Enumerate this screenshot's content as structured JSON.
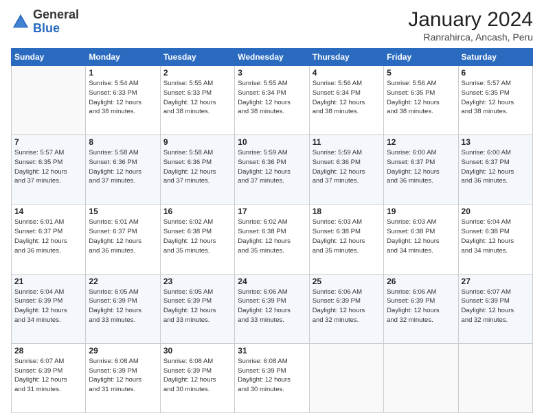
{
  "header": {
    "logo_general": "General",
    "logo_blue": "Blue",
    "title": "January 2024",
    "location": "Ranrahirca, Ancash, Peru"
  },
  "days_of_week": [
    "Sunday",
    "Monday",
    "Tuesday",
    "Wednesday",
    "Thursday",
    "Friday",
    "Saturday"
  ],
  "weeks": [
    [
      {
        "day": "",
        "info": ""
      },
      {
        "day": "1",
        "info": "Sunrise: 5:54 AM\nSunset: 6:33 PM\nDaylight: 12 hours\nand 38 minutes."
      },
      {
        "day": "2",
        "info": "Sunrise: 5:55 AM\nSunset: 6:33 PM\nDaylight: 12 hours\nand 38 minutes."
      },
      {
        "day": "3",
        "info": "Sunrise: 5:55 AM\nSunset: 6:34 PM\nDaylight: 12 hours\nand 38 minutes."
      },
      {
        "day": "4",
        "info": "Sunrise: 5:56 AM\nSunset: 6:34 PM\nDaylight: 12 hours\nand 38 minutes."
      },
      {
        "day": "5",
        "info": "Sunrise: 5:56 AM\nSunset: 6:35 PM\nDaylight: 12 hours\nand 38 minutes."
      },
      {
        "day": "6",
        "info": "Sunrise: 5:57 AM\nSunset: 6:35 PM\nDaylight: 12 hours\nand 38 minutes."
      }
    ],
    [
      {
        "day": "7",
        "info": "Sunrise: 5:57 AM\nSunset: 6:35 PM\nDaylight: 12 hours\nand 37 minutes."
      },
      {
        "day": "8",
        "info": "Sunrise: 5:58 AM\nSunset: 6:36 PM\nDaylight: 12 hours\nand 37 minutes."
      },
      {
        "day": "9",
        "info": "Sunrise: 5:58 AM\nSunset: 6:36 PM\nDaylight: 12 hours\nand 37 minutes."
      },
      {
        "day": "10",
        "info": "Sunrise: 5:59 AM\nSunset: 6:36 PM\nDaylight: 12 hours\nand 37 minutes."
      },
      {
        "day": "11",
        "info": "Sunrise: 5:59 AM\nSunset: 6:36 PM\nDaylight: 12 hours\nand 37 minutes."
      },
      {
        "day": "12",
        "info": "Sunrise: 6:00 AM\nSunset: 6:37 PM\nDaylight: 12 hours\nand 36 minutes."
      },
      {
        "day": "13",
        "info": "Sunrise: 6:00 AM\nSunset: 6:37 PM\nDaylight: 12 hours\nand 36 minutes."
      }
    ],
    [
      {
        "day": "14",
        "info": "Sunrise: 6:01 AM\nSunset: 6:37 PM\nDaylight: 12 hours\nand 36 minutes."
      },
      {
        "day": "15",
        "info": "Sunrise: 6:01 AM\nSunset: 6:37 PM\nDaylight: 12 hours\nand 36 minutes."
      },
      {
        "day": "16",
        "info": "Sunrise: 6:02 AM\nSunset: 6:38 PM\nDaylight: 12 hours\nand 35 minutes."
      },
      {
        "day": "17",
        "info": "Sunrise: 6:02 AM\nSunset: 6:38 PM\nDaylight: 12 hours\nand 35 minutes."
      },
      {
        "day": "18",
        "info": "Sunrise: 6:03 AM\nSunset: 6:38 PM\nDaylight: 12 hours\nand 35 minutes."
      },
      {
        "day": "19",
        "info": "Sunrise: 6:03 AM\nSunset: 6:38 PM\nDaylight: 12 hours\nand 34 minutes."
      },
      {
        "day": "20",
        "info": "Sunrise: 6:04 AM\nSunset: 6:38 PM\nDaylight: 12 hours\nand 34 minutes."
      }
    ],
    [
      {
        "day": "21",
        "info": "Sunrise: 6:04 AM\nSunset: 6:39 PM\nDaylight: 12 hours\nand 34 minutes."
      },
      {
        "day": "22",
        "info": "Sunrise: 6:05 AM\nSunset: 6:39 PM\nDaylight: 12 hours\nand 33 minutes."
      },
      {
        "day": "23",
        "info": "Sunrise: 6:05 AM\nSunset: 6:39 PM\nDaylight: 12 hours\nand 33 minutes."
      },
      {
        "day": "24",
        "info": "Sunrise: 6:06 AM\nSunset: 6:39 PM\nDaylight: 12 hours\nand 33 minutes."
      },
      {
        "day": "25",
        "info": "Sunrise: 6:06 AM\nSunset: 6:39 PM\nDaylight: 12 hours\nand 32 minutes."
      },
      {
        "day": "26",
        "info": "Sunrise: 6:06 AM\nSunset: 6:39 PM\nDaylight: 12 hours\nand 32 minutes."
      },
      {
        "day": "27",
        "info": "Sunrise: 6:07 AM\nSunset: 6:39 PM\nDaylight: 12 hours\nand 32 minutes."
      }
    ],
    [
      {
        "day": "28",
        "info": "Sunrise: 6:07 AM\nSunset: 6:39 PM\nDaylight: 12 hours\nand 31 minutes."
      },
      {
        "day": "29",
        "info": "Sunrise: 6:08 AM\nSunset: 6:39 PM\nDaylight: 12 hours\nand 31 minutes."
      },
      {
        "day": "30",
        "info": "Sunrise: 6:08 AM\nSunset: 6:39 PM\nDaylight: 12 hours\nand 30 minutes."
      },
      {
        "day": "31",
        "info": "Sunrise: 6:08 AM\nSunset: 6:39 PM\nDaylight: 12 hours\nand 30 minutes."
      },
      {
        "day": "",
        "info": ""
      },
      {
        "day": "",
        "info": ""
      },
      {
        "day": "",
        "info": ""
      }
    ]
  ]
}
